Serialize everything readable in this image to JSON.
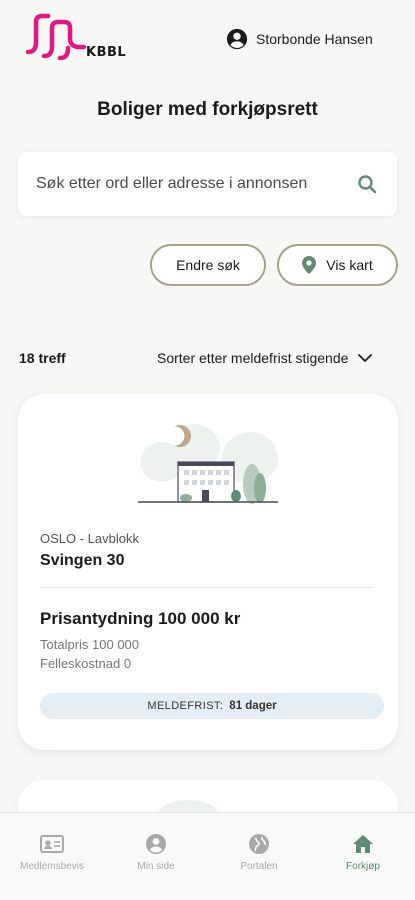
{
  "header": {
    "brand": "KBBL",
    "user_name": "Storbonde Hansen"
  },
  "page": {
    "title": "Boliger med forkjøpsrett"
  },
  "search": {
    "placeholder": "Søk etter ord eller adresse i annonsen"
  },
  "actions": {
    "edit_search": "Endre søk",
    "show_map": "Vis kart"
  },
  "results": {
    "count": "18 treff",
    "sort_label": "Sorter etter meldefrist stigende"
  },
  "listing": {
    "meta": "OSLO - Lavblokk",
    "address": "Svingen 30",
    "price": "Prisantydning 100 000 kr",
    "total_price": "Totalpris 100 000",
    "shared_cost": "Felleskostnad 0",
    "deadline_label": "MELDEFRIST:",
    "deadline_value": "81 dager"
  },
  "nav": {
    "items": [
      {
        "label": "Medlemsbevis",
        "icon": "member-card-icon"
      },
      {
        "label": "Min side",
        "icon": "person-icon"
      },
      {
        "label": "Portalen",
        "icon": "globe-icon"
      },
      {
        "label": "Forkjøp",
        "icon": "home-icon"
      }
    ]
  },
  "colors": {
    "brand_pink": "#e2187f",
    "accent_green": "#5f8c73",
    "pill_border": "#a7a188",
    "deadline_bg": "#e6eef5"
  }
}
